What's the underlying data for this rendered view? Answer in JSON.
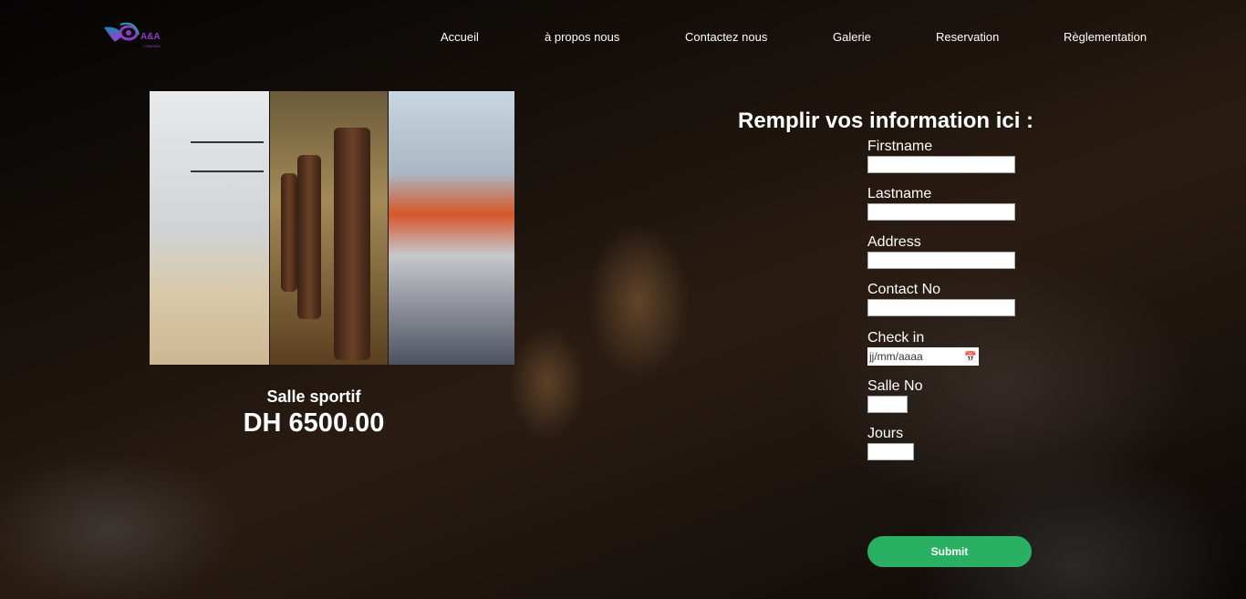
{
  "logo": {
    "text": "A&A",
    "subtext": "COMPANY"
  },
  "nav": [
    "Accueil",
    "à propos nous",
    "Contactez nous",
    "Galerie",
    "Reservation",
    "Règlementation"
  ],
  "product": {
    "name": "Salle sportif",
    "price": "DH 6500.00"
  },
  "form": {
    "title": "Remplir vos information ici :",
    "fields": {
      "firstname": "Firstname",
      "lastname": "Lastname",
      "address": "Address",
      "contact": "Contact No",
      "checkin": "Check in",
      "salle": "Salle No",
      "jours": "Jours"
    },
    "date_placeholder": "jj/mm/aaaa",
    "submit": "Submit"
  },
  "colors": {
    "submit": "#2ab062",
    "logo": "#8a3fc8"
  }
}
